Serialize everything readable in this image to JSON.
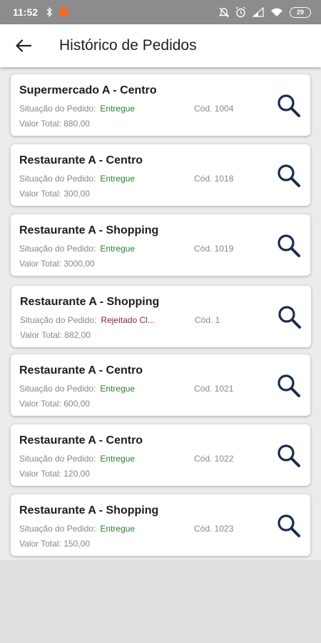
{
  "status_bar": {
    "time": "11:52",
    "battery": "29"
  },
  "app_bar": {
    "title": "Histórico de Pedidos"
  },
  "orders": [
    {
      "store": "Supermercado A - Centro",
      "status_label": "Situação do Pedido:",
      "status": "Entregue",
      "code": "Cód. 1004",
      "total": "Valor Total: 880,00"
    },
    {
      "store": "Restaurante A - Centro",
      "status_label": "Situação do Pedido:",
      "status": "Entregue",
      "code": "Cód. 1018",
      "total": "Valor Total: 300,00"
    },
    {
      "store": "Restaurante A - Shopping",
      "status_label": "Situação do Pedido:",
      "status": "Entregue",
      "code": "Cód. 1019",
      "total": "Valor Total: 3000,00"
    },
    {
      "store": "Restaurante A - Shopping",
      "status_label": "Situação do Pedido:",
      "status": "Rejeitado Cl...",
      "code": "Cód. 1",
      "total": "Valor Total: 882,00"
    },
    {
      "store": "Restaurante A - Centro",
      "status_label": "Situação do Pedido:",
      "status": "Entregue",
      "code": "Cód. 1021",
      "total": "Valor Total: 600,00"
    },
    {
      "store": "Restaurante A - Centro",
      "status_label": "Situação do Pedido:",
      "status": "Entregue",
      "code": "Cód. 1022",
      "total": "Valor Total: 120,00"
    },
    {
      "store": "Restaurante A - Shopping",
      "status_label": "Situação do Pedido:",
      "status": "Entregue",
      "code": "Cód. 1023",
      "total": "Valor Total: 150,00"
    }
  ],
  "colors": {
    "status_delivered": "#2e7d32",
    "status_rejected": "#8b2a2a",
    "search_icon": "#1a2d4f"
  },
  "icons": {
    "back": "arrow-left-icon",
    "search": "search-icon",
    "bluetooth": "bluetooth-icon",
    "mute": "bell-off-icon",
    "alarm": "alarm-icon",
    "signal": "signal-icon",
    "wifi": "wifi-icon",
    "battery": "battery-icon"
  }
}
